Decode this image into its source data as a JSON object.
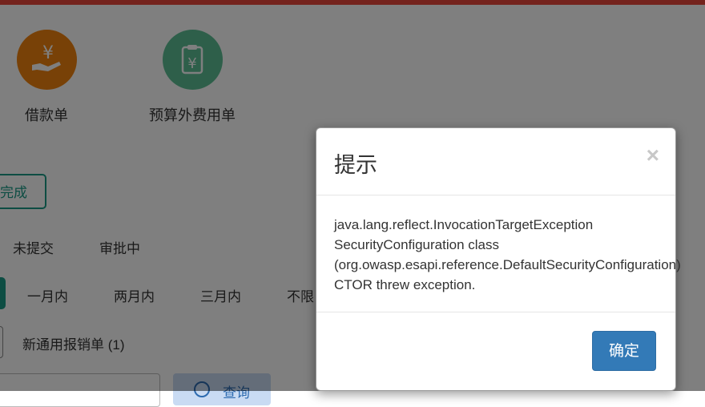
{
  "tiles": [
    {
      "label": "借款单",
      "icon": "yen-hand-icon",
      "color": "#f0830e"
    },
    {
      "label": "预算外费用单",
      "icon": "yen-clipboard-icon",
      "color": "#5cbf94"
    }
  ],
  "done_button": "完成",
  "status_filters": [
    "未提交",
    "审批中"
  ],
  "time_filters": [
    "一月内",
    "两月内",
    "三月内",
    "不限"
  ],
  "type_filter": "新通用报销单 (1)",
  "search": {
    "button_label": "查询"
  },
  "modal": {
    "title": "提示",
    "close_label": "×",
    "message": "java.lang.reflect.InvocationTargetException\nSecurityConfiguration class\n(org.owasp.esapi.reference.DefaultSecurityConfiguration)\nCTOR threw exception.",
    "ok_label": "确定"
  },
  "colors": {
    "accent": "#1a9a87",
    "top_bar": "#e8473b",
    "primary_button": "#337ab7"
  }
}
